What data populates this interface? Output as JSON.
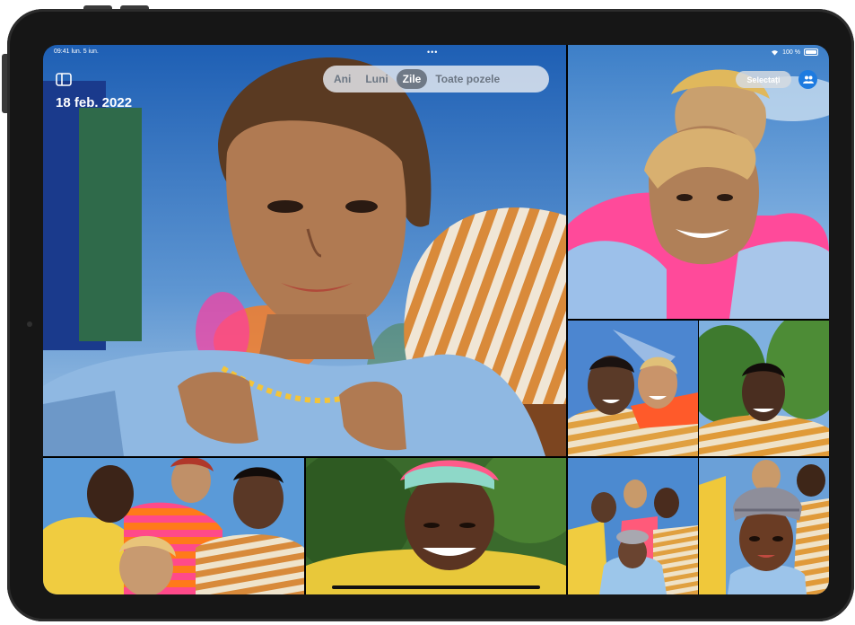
{
  "status_bar": {
    "time_date": "09:41 lun. 5 iun.",
    "battery": "100 %",
    "battery_level": 1.0
  },
  "header": {
    "date_title": "18 feb. 2022"
  },
  "view_tabs": [
    {
      "label": "Ani",
      "selected": false
    },
    {
      "label": "Luni",
      "selected": false
    },
    {
      "label": "Zile",
      "selected": true
    },
    {
      "label": "Toate pozele",
      "selected": false
    }
  ],
  "toolbar": {
    "select_label": "Selectați"
  },
  "icons": {
    "sidebar": "sidebar-icon",
    "multitasking": "more-dots-icon",
    "wifi": "wifi-icon",
    "battery": "battery-icon",
    "people": "people-icon"
  },
  "colors": {
    "accent": "#1d7be0",
    "segment_selected": "#6f7986"
  }
}
